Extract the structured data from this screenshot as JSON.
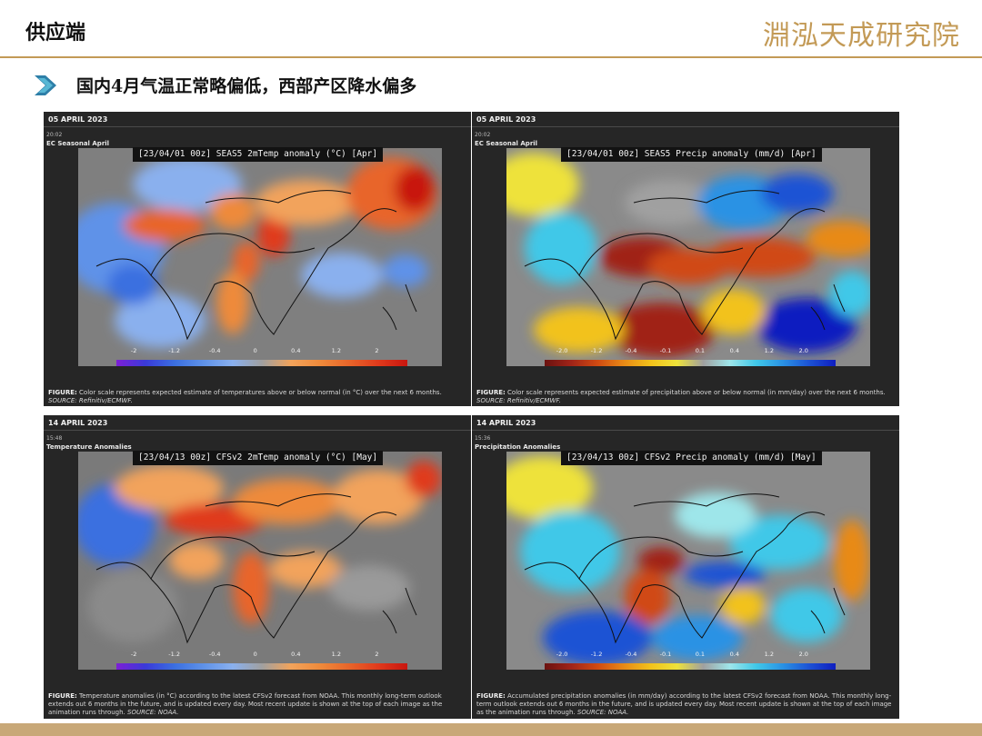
{
  "header": {
    "title": "供应端",
    "logo_text": "淵泓天成研究院"
  },
  "subtitle": "国内4月气温正常略偏低，西部产区降水偏多",
  "panels": [
    {
      "date": "05 APRIL 2023",
      "time": "20:02",
      "subhead": "EC Seasonal April",
      "map_title": "[23/04/01 00z] SEAS5 2mTemp anomaly (°C) [Apr]",
      "ticks": [
        "-2",
        "-1.2",
        "-0.4",
        "0",
        "0.4",
        "1.2",
        "2"
      ],
      "caption_label": "FIGURE:",
      "caption_text": "Color scale represents expected estimate of temperatures above or below normal (in °C) over the next 6 months.",
      "caption_source": "SOURCE: Refinitiv/ECMWF."
    },
    {
      "date": "05 APRIL 2023",
      "time": "20:02",
      "subhead": "EC Seasonal April",
      "map_title": "[23/04/01 00z] SEAS5 Precip anomaly (mm/d) [Apr]",
      "ticks": [
        "-2.0",
        "-1.2",
        "-0.4",
        "-0.1",
        "0.1",
        "0.4",
        "1.2",
        "2.0"
      ],
      "caption_label": "FIGURE:",
      "caption_text": "Color scale represents expected estimate of precipitation above or below normal (in mm/day) over the next 6 months.",
      "caption_source": "SOURCE: Refinitiv/ECMWF."
    },
    {
      "date": "14 APRIL 2023",
      "time": "15:48",
      "subhead": "Temperature Anomalies",
      "map_title": "[23/04/13 00z] CFSv2 2mTemp anomaly (°C) [May]",
      "ticks": [
        "-2",
        "-1.2",
        "-0.4",
        "0",
        "0.4",
        "1.2",
        "2"
      ],
      "caption_label": "FIGURE:",
      "caption_text": "Temperature anomalies (in °C) according to the latest CFSv2 forecast from NOAA. This monthly long-term outlook extends out 6 months in the future, and is updated every day. Most recent update is shown at the top of each image as the animation runs through.",
      "caption_source": "SOURCE: NOAA."
    },
    {
      "date": "14 APRIL 2023",
      "time": "15:36",
      "subhead": "Precipitation Anomalies",
      "map_title": "[23/04/13 00z] CFSv2 Precip anomaly (mm/d) [May]",
      "ticks": [
        "-2.0",
        "-1.2",
        "-0.4",
        "-0.1",
        "0.1",
        "0.4",
        "1.2",
        "2.0"
      ],
      "caption_label": "FIGURE:",
      "caption_text": "Accumulated precipitation anomalies (in mm/day) according to the latest CFSv2 forecast from NOAA. This monthly long-term outlook extends out 6 months in the future, and is updated every day. Most recent update is shown at the top of each image as the animation runs through.",
      "caption_source": "SOURCE: NOAA."
    }
  ],
  "colors": {
    "brand_gold": "#c39a56",
    "panel_bg": "#262626",
    "temp_scale": [
      "#7d1fd6",
      "#3a3ad9",
      "#3b6fe0",
      "#5f92e8",
      "#8ab0ee",
      "#a0a0a0",
      "#f2a35b",
      "#ee8a3b",
      "#e8652a",
      "#e03a1c",
      "#c8160f"
    ],
    "precip_scale": [
      "#6b1210",
      "#a02418",
      "#d04a12",
      "#e88a16",
      "#f2c21a",
      "#eee23a",
      "#a0a0a0",
      "#9ee6ea",
      "#40c8e8",
      "#2a92e4",
      "#1c52d4",
      "#0f1ec0"
    ]
  },
  "icons": {
    "bullet": "chevron-right-icon"
  }
}
